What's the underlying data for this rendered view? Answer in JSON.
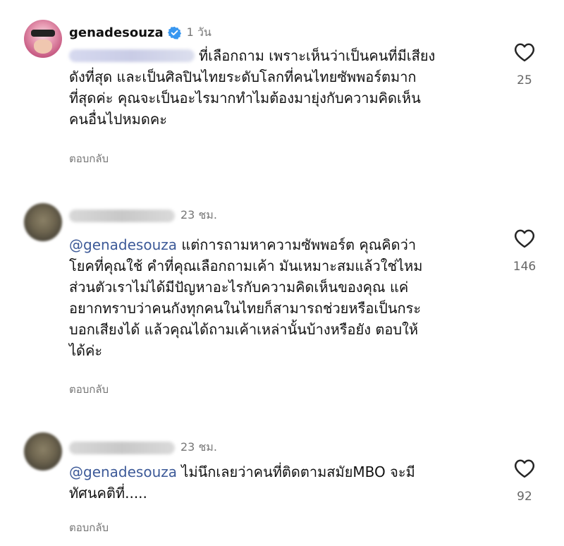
{
  "comments": [
    {
      "username": "genadesouza",
      "verified": true,
      "time": "1 วัน",
      "lines": [
        "ที่เลือกถาม เพราะเห็นว่าเป็นคนที่มีเสียง",
        "ดังที่สุด และเป็นศิลปินไทยระดับโลกที่คนไทยซัพพอร์ตมาก",
        "ที่สุดค่ะ คุณจะเป็นอะไรมากทำไมต้องมายุ่งกับความคิดเห็น",
        "คนอื่นไปหมดคะ"
      ],
      "reply_label": "ตอบกลับ",
      "likes": "25"
    },
    {
      "time": "23 ชม.",
      "mention": "@genadesouza",
      "lines": [
        " แต่การถามหาความซัพพอร์ต คุณคิดว่า",
        "โยคที่คุณใช้ คำที่คุณเลือกถามเค้า มันเหมาะสมแล้วใช่ไหม",
        "ส่วนตัวเราไม่ได้มีปัญหาอะไรกับความคิดเห็นของคุณ แค่",
        "อยากทราบว่าคนกังทุกคนในไทยก็สามารถช่วยหรือเป็นกระ",
        "บอกเสียงได้ แล้วคุณได้ถามเค้าเหล่านั้นบ้างหรือยัง ตอบให้",
        "ได้ค่ะ"
      ],
      "reply_label": "ตอบกลับ",
      "likes": "146"
    },
    {
      "time": "23 ชม.",
      "mention": "@genadesouza",
      "lines": [
        " ไม่นึกเลยว่าคนที่ติดตามสมัยMBO จะมี",
        "ทัศนคติที่....."
      ],
      "reply_label": "ตอบกลับ",
      "likes": "92"
    }
  ],
  "colors": {
    "mention": "#3d5a98",
    "verified": "#3897f0",
    "muted": "#777777"
  },
  "icons": {
    "like": "heart-outline-icon",
    "verified": "verified-badge-icon"
  }
}
